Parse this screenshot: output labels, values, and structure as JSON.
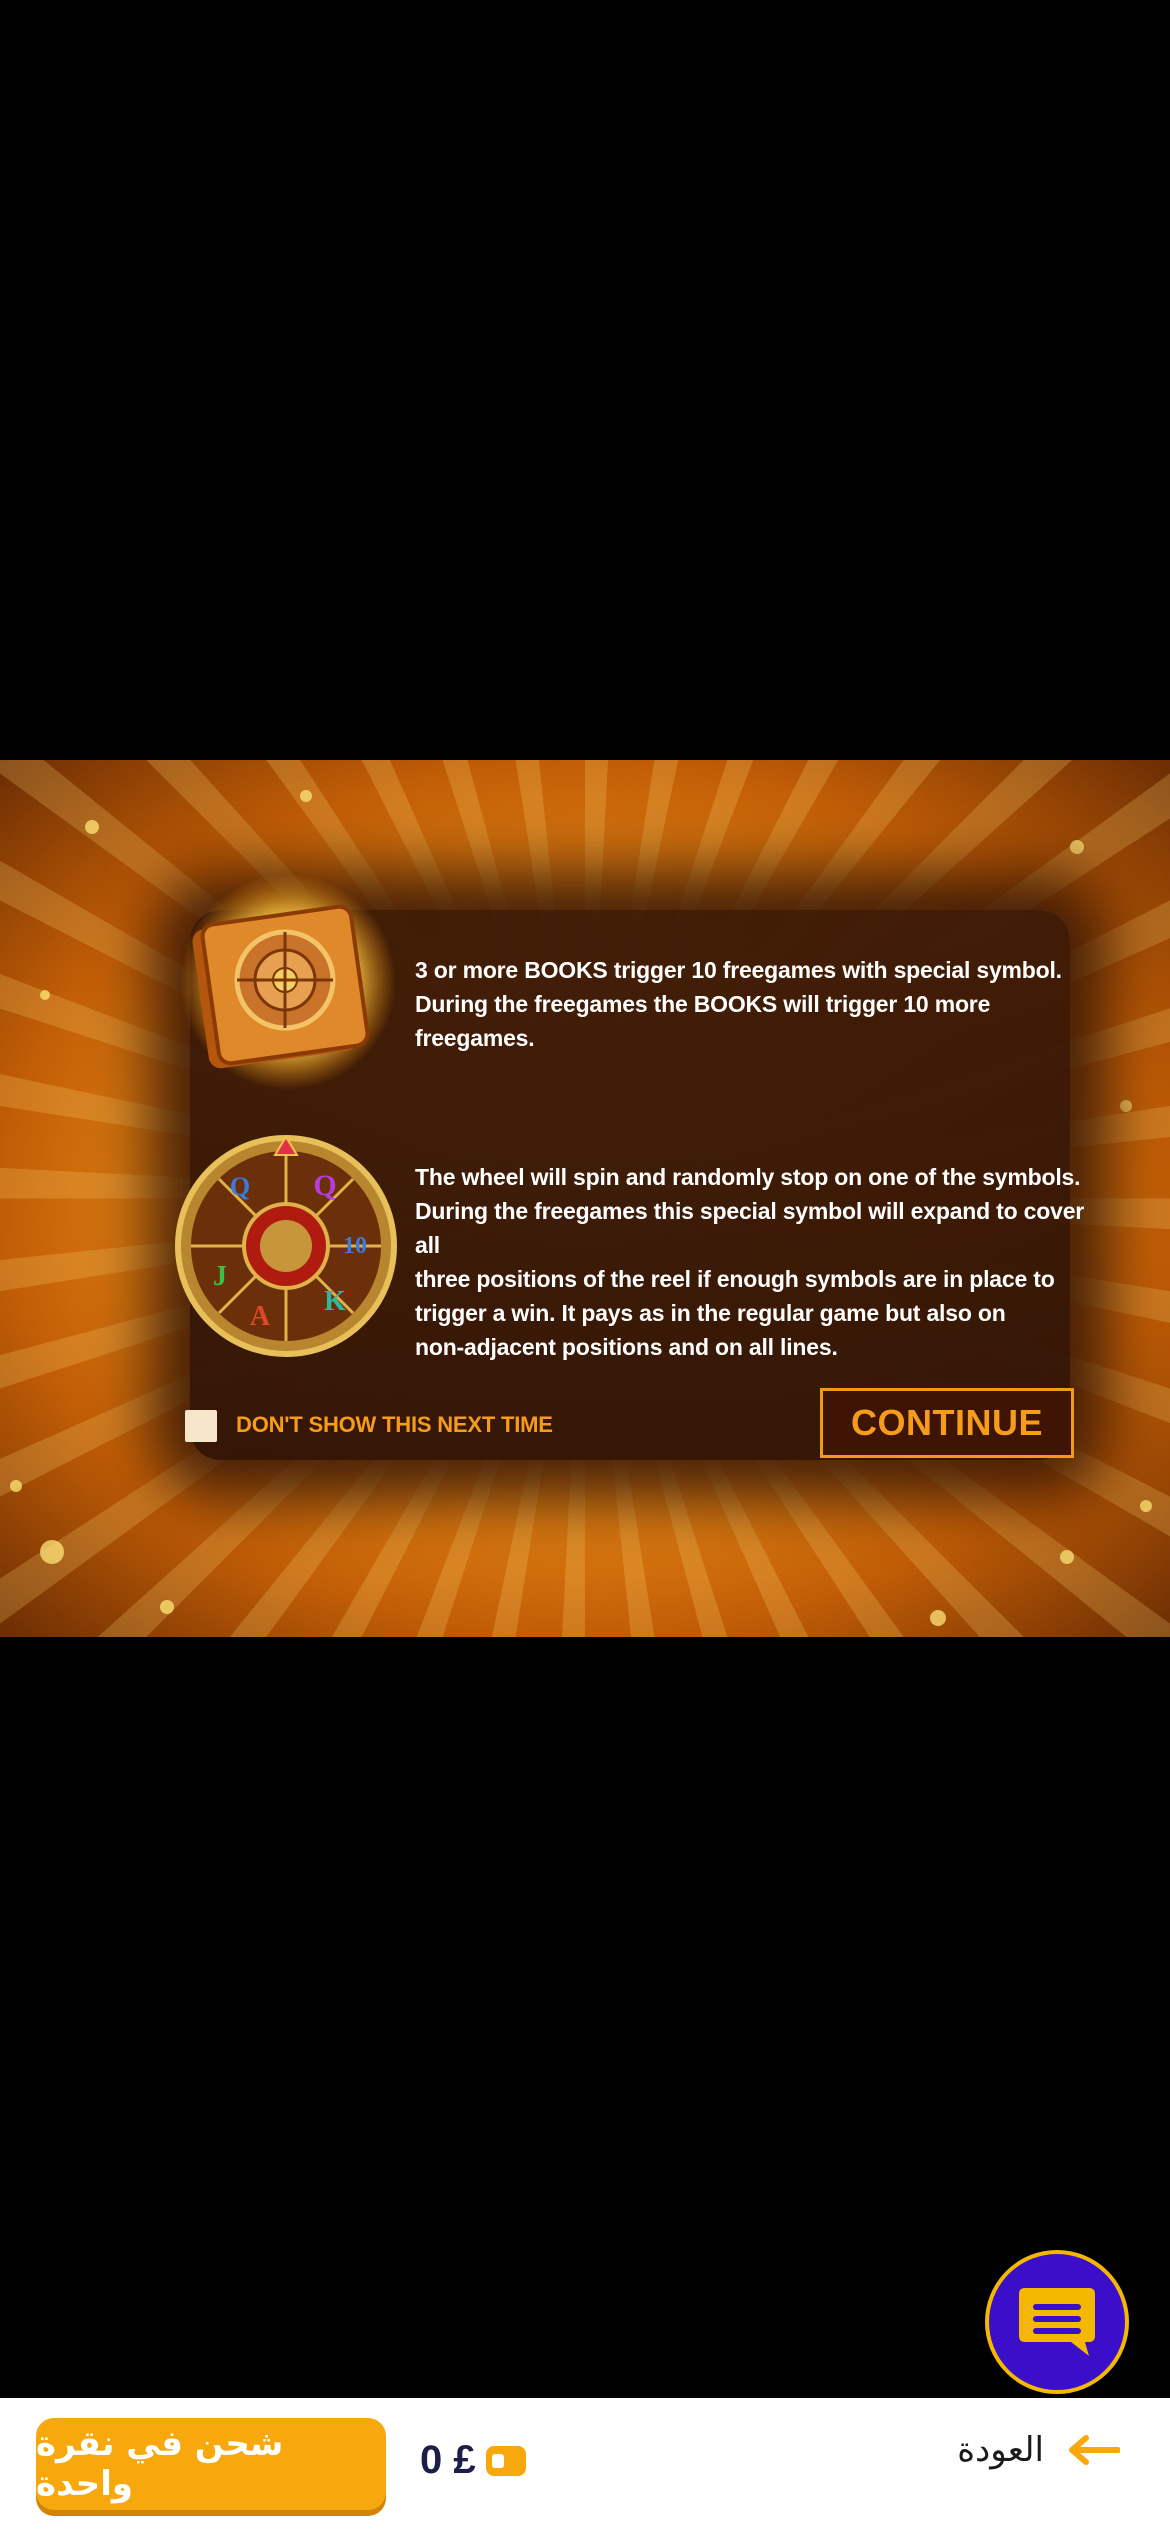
{
  "game": {
    "info1": {
      "line1": "3 or more BOOKS trigger 10 freegames with special symbol.",
      "line2": "During the freegames the BOOKS will trigger 10 more freegames."
    },
    "info2": {
      "line1": "The wheel will spin and randomly stop on one of the symbols.",
      "line2": "During the freegames this special symbol will expand to cover all",
      "line3": "three positions of the reel if enough symbols are in place to",
      "line4": "trigger a win.  It pays as in the regular game but also on",
      "line5": "non-adjacent positions and on all lines."
    },
    "dont_show_label": "DON'T SHOW THIS NEXT TIME",
    "continue_label": "CONTINUE",
    "wheel_symbols": [
      "Q",
      "10",
      "K",
      "A",
      "J",
      "Q",
      "10"
    ]
  },
  "bottom_bar": {
    "topup_label": "شحن في نقرة واحدة",
    "balance": "0 £",
    "back_label": "العودة"
  },
  "colors": {
    "accent": "#f7a80d",
    "chat_bg": "#3b0fc9",
    "continue_text": "#f59c1a"
  },
  "icons": [
    "book-icon",
    "wheel-icon",
    "chat-icon",
    "wallet-icon",
    "back-arrow-icon"
  ]
}
